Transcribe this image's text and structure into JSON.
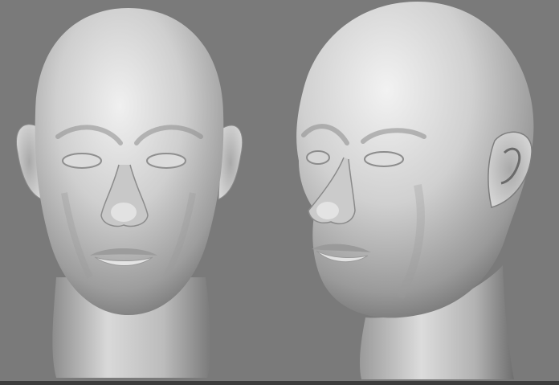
{
  "viewport": {
    "background": "#7a7a7a",
    "views": [
      {
        "view": "front"
      },
      {
        "view": "three-quarter-left"
      }
    ]
  },
  "colors": {
    "skin_light": "#e9e9e9",
    "skin_mid": "#bdbdbd",
    "skin_dark": "#6e6e6e",
    "bottom_bar": "#3c3c3c"
  }
}
